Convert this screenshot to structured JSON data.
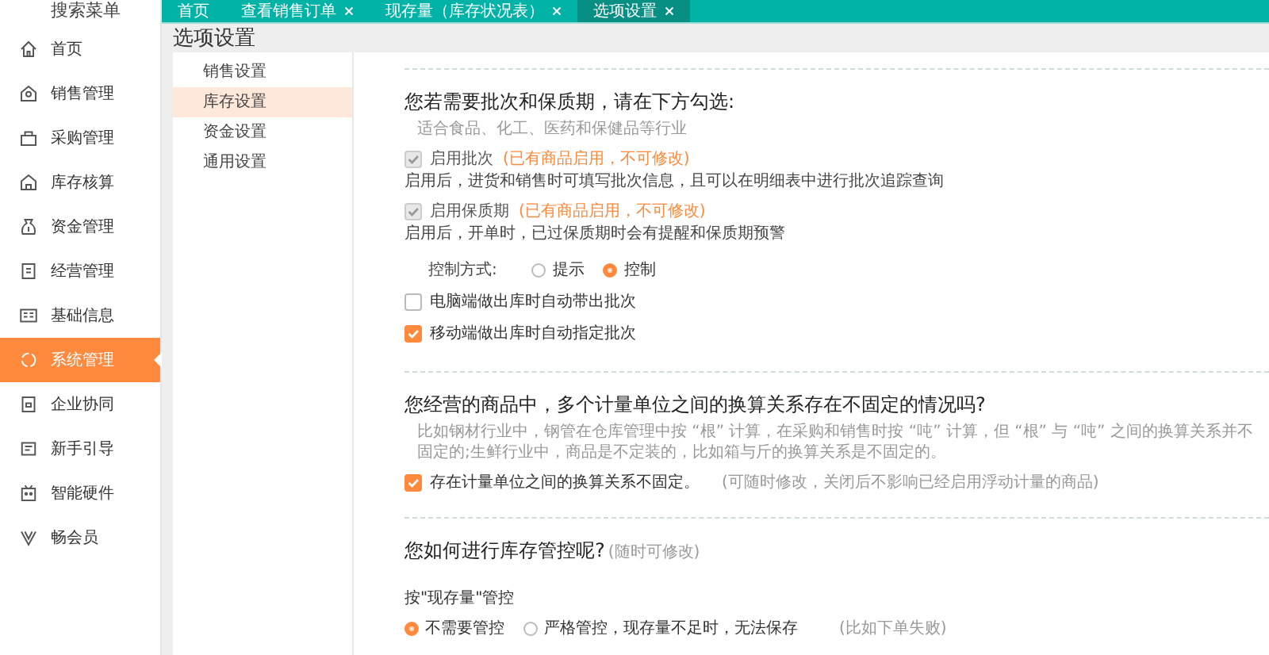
{
  "sidebar": {
    "search_label": "搜索菜单",
    "items": [
      {
        "label": "首页",
        "selected": false
      },
      {
        "label": "销售管理",
        "selected": false
      },
      {
        "label": "采购管理",
        "selected": false
      },
      {
        "label": "库存核算",
        "selected": false
      },
      {
        "label": "资金管理",
        "selected": false
      },
      {
        "label": "经营管理",
        "selected": false
      },
      {
        "label": "基础信息",
        "selected": false
      },
      {
        "label": "系统管理",
        "selected": true
      },
      {
        "label": "企业协同",
        "selected": false
      },
      {
        "label": "新手引导",
        "selected": false
      },
      {
        "label": "智能硬件",
        "selected": false
      },
      {
        "label": "畅会员",
        "selected": false
      }
    ]
  },
  "tabs": [
    {
      "label": "首页",
      "closable": false,
      "selected": false
    },
    {
      "label": "查看销售订单",
      "closable": true,
      "selected": false
    },
    {
      "label": "现存量（库存状况表）",
      "closable": true,
      "selected": false
    },
    {
      "label": "选项设置",
      "closable": true,
      "selected": true
    }
  ],
  "page_title": "选项设置",
  "settings_menu": [
    {
      "label": "销售设置",
      "selected": false
    },
    {
      "label": "库存设置",
      "selected": true
    },
    {
      "label": "资金设置",
      "selected": false
    },
    {
      "label": "通用设置",
      "selected": false
    }
  ],
  "sections": [
    {
      "title": "您若需要批次和保质期，请在下方勾选:",
      "hint": "适合食品、化工、医药和保健品等行业",
      "items": [
        {
          "kind": "checkbox",
          "label": "启用批次",
          "checked": true,
          "disabled": true,
          "note": "(已有商品启用，不可修改)",
          "description": "启用后，进货和销售时可填写批次信息，且可以在明细表中进行批次追踪查询"
        },
        {
          "kind": "checkbox",
          "label": "启用保质期",
          "checked": true,
          "disabled": true,
          "note": "(已有商品启用，不可修改)",
          "description": "启用后，开单时，已过保质期时会有提醒和保质期预警"
        },
        {
          "kind": "radio_group",
          "label": "控制方式:",
          "options": [
            {
              "label": "提示",
              "selected": false
            },
            {
              "label": "控制",
              "selected": true
            }
          ]
        },
        {
          "kind": "checkbox",
          "label": "电脑端做出库时自动带出批次",
          "checked": false,
          "disabled": false
        },
        {
          "kind": "checkbox",
          "label": "移动端做出库时自动指定批次",
          "checked": true,
          "disabled": false
        }
      ]
    },
    {
      "title": "您经营的商品中，多个计量单位之间的换算关系存在不固定的情况吗?",
      "hint": "比如钢材行业中，钢管在仓库管理中按 “根” 计算，在采购和销售时按 “吨” 计算，但 “根” 与 “吨” 之间的换算关系并不固定的;生鲜行业中，商品是不定装的，比如箱与斤的换算关系是不固定的。",
      "items": [
        {
          "kind": "checkbox",
          "label": "存在计量单位之间的换算关系不固定。",
          "checked": true,
          "disabled": false,
          "note": "(可随时修改，关闭后不影响已经启用浮动计量的商品)"
        }
      ]
    },
    {
      "title": "您如何进行库存管控呢?",
      "title_note": "(随时可修改)",
      "items": [
        {
          "kind": "heading",
          "label": "按\"现存量\"管控"
        },
        {
          "kind": "radio_group",
          "options": [
            {
              "label": "不需要管控",
              "selected": true
            },
            {
              "label": "严格管控，现存量不足时，无法保存",
              "selected": false
            }
          ],
          "note": "(比如下单失败)"
        }
      ]
    }
  ]
}
